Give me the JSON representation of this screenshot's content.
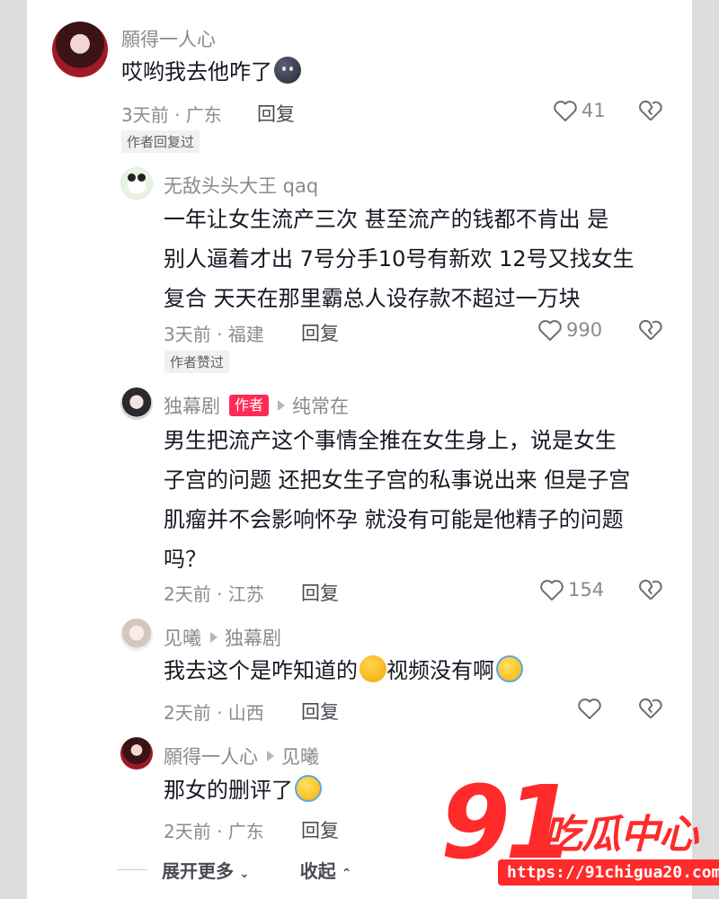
{
  "comments": [
    {
      "author": "願得一人心",
      "text": "哎哟我去他咋了",
      "meta": "3天前 · 广东",
      "reply_label": "回复",
      "likes": "41",
      "tag": "作者回复过"
    },
    {
      "author": "无敌头头大王 qaq",
      "lines": [
        "一年让女生流产三次  甚至流产的钱都不肯出 是",
        "别人逼着才出 7号分手10号有新欢 12号又找女生",
        "复合 天天在那里霸总人设存款不超过一万块"
      ],
      "meta": "3天前 · 福建",
      "reply_label": "回复",
      "likes": "990",
      "tag": "作者赞过"
    },
    {
      "author": "独幕剧",
      "badge": "作者",
      "reply_to": "纯常在",
      "lines": [
        "男生把流产这个事情全推在女生身上，说是女生",
        "子宫的问题 还把女生子宫的私事说出来 但是子宫",
        "肌瘤并不会影响怀孕 就没有可能是他精子的问题",
        "吗？"
      ],
      "meta": "2天前 · 江苏",
      "reply_label": "回复",
      "likes": "154"
    },
    {
      "author": "见曦",
      "reply_to": "独幕剧",
      "text_a": "我去这个是咋知道的",
      "text_b": "视频没有啊",
      "meta": "2天前 · 山西",
      "reply_label": "回复"
    },
    {
      "author": "願得一人心",
      "reply_to": "见曦",
      "text": "那女的删评了",
      "meta": "2天前 · 广东",
      "reply_label": "回复"
    }
  ],
  "footer": {
    "expand_label": "展开更多",
    "collapse_label": "收起"
  },
  "watermark": {
    "number": "91",
    "name": "吃瓜中心",
    "url": "https://91chigua20.com"
  },
  "emojis": [
    "dark-face-emoji",
    "angry-face-emoji",
    "laughing-crying-emoji"
  ],
  "colors": {
    "accent": "#fe2c55",
    "watermark": "#ff2a2a"
  }
}
